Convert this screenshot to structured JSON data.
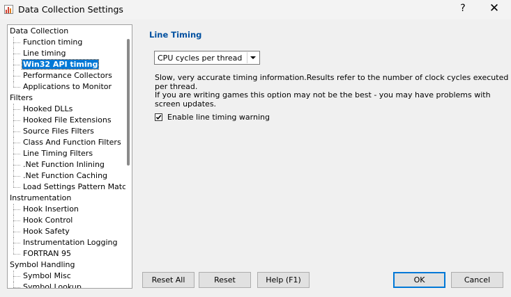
{
  "window": {
    "title": "Data Collection Settings",
    "help_glyph": "?",
    "close_glyph": "✕"
  },
  "tree": [
    {
      "label": "Data Collection",
      "level": 0
    },
    {
      "label": "Function timing",
      "level": 1
    },
    {
      "label": "Line timing",
      "level": 1
    },
    {
      "label": "Win32 API timing",
      "level": 1,
      "selected": true
    },
    {
      "label": "Performance Collectors",
      "level": 1
    },
    {
      "label": "Applications to Monitor",
      "level": 1,
      "last": true
    },
    {
      "label": "Filters",
      "level": 0
    },
    {
      "label": "Hooked DLLs",
      "level": 1
    },
    {
      "label": "Hooked File Extensions",
      "level": 1
    },
    {
      "label": "Source Files Filters",
      "level": 1
    },
    {
      "label": "Class And Function Filters",
      "level": 1
    },
    {
      "label": "Line Timing Filters",
      "level": 1
    },
    {
      "label": ".Net Function Inlining",
      "level": 1
    },
    {
      "label": ".Net Function Caching",
      "level": 1
    },
    {
      "label": "Load Settings Pattern Match",
      "level": 1,
      "last": true
    },
    {
      "label": "Instrumentation",
      "level": 0
    },
    {
      "label": "Hook Insertion",
      "level": 1
    },
    {
      "label": "Hook Control",
      "level": 1
    },
    {
      "label": "Hook Safety",
      "level": 1
    },
    {
      "label": "Instrumentation Logging",
      "level": 1
    },
    {
      "label": "FORTRAN 95",
      "level": 1,
      "last": true
    },
    {
      "label": "Symbol Handling",
      "level": 0
    },
    {
      "label": "Symbol Misc",
      "level": 1
    },
    {
      "label": "Symbol Lookup",
      "level": 1
    }
  ],
  "panel": {
    "title": "Line Timing",
    "dropdown_value": "CPU cycles per thread",
    "description1": "Slow, very accurate timing information.Results refer to the number of clock cycles executed per thread.",
    "description2": "If you are writing games this option may not be the best - you may have problems with screen updates.",
    "checkbox_label": "Enable line timing warning",
    "checkbox_checked": true
  },
  "buttons": {
    "reset_all": "Reset All",
    "reset": "Reset",
    "help": "Help (F1)",
    "ok": "OK",
    "cancel": "Cancel"
  },
  "colors": {
    "selection": "#0078d7",
    "section_title": "#0050a0"
  }
}
